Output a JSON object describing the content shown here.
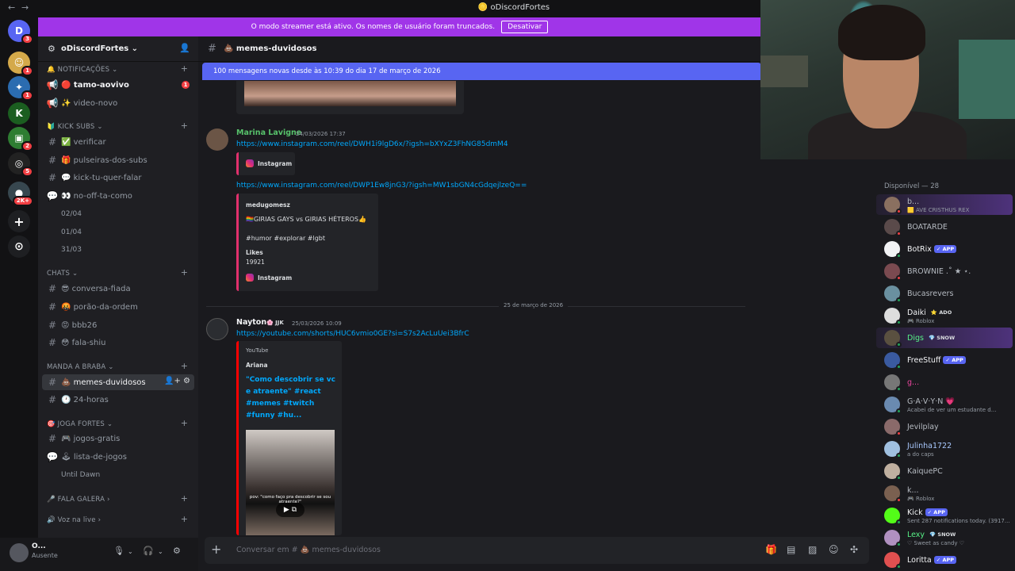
{
  "titlebar": {
    "back": "←",
    "forward": "→",
    "title": "oDiscordFortes"
  },
  "banner": {
    "text": "O modo streamer está ativo. Os nomes de usuário foram truncados.",
    "button": "Desativar"
  },
  "rail": {
    "servers": [
      {
        "label": "D",
        "badge": "3",
        "color": "#5865f2"
      },
      {
        "label": "☺",
        "badge": "1",
        "color": "#d4a94a"
      },
      {
        "label": "✦",
        "badge": "1",
        "color": "#2b6cb0"
      },
      {
        "label": "K",
        "badge": "",
        "color": "#1b5e20"
      },
      {
        "label": "▣",
        "badge": "2",
        "color": "#2e7d32"
      },
      {
        "label": "◎",
        "badge": "5",
        "color": "#222"
      },
      {
        "label": "●",
        "badge": "2K+",
        "color": "#37474f"
      }
    ],
    "add": "+",
    "explore": "⊙"
  },
  "server": {
    "name": "oDiscordFortes ⌄"
  },
  "sidebar": {
    "categories": [
      {
        "label": "🔔 NOTIFICAÇÕES ⌄"
      },
      {
        "label": "🔰 KICK SUBS ⌄"
      },
      {
        "label": "CHATS ⌄"
      },
      {
        "label": "MANDA A BRABA ⌄"
      },
      {
        "label": "🎯 JOGA FORTES ⌄"
      },
      {
        "label": "🎤 FALA GALERA ›"
      },
      {
        "label": "🔊 Voz na live ›"
      }
    ],
    "channels": [
      {
        "icon": "📢",
        "label": "🔴 tamo-aovivo",
        "badge": "1"
      },
      {
        "icon": "📢",
        "label": "✨ video-novo"
      },
      {
        "icon": "#",
        "label": "✅ verificar"
      },
      {
        "icon": "#",
        "label": "🎁 pulseiras-dos-subs"
      },
      {
        "icon": "#",
        "label": "💬 kick-tu-quer-falar"
      },
      {
        "icon": "💬",
        "label": "👀 no-off-ta-como"
      },
      {
        "icon": "#",
        "label": "😎 conversa-fiada"
      },
      {
        "icon": "#",
        "label": "🤬 porão-da-ordem"
      },
      {
        "icon": "#",
        "label": "😡 bbb26"
      },
      {
        "icon": "#",
        "label": "😳 fala-shiu"
      },
      {
        "icon": "#",
        "label": "💩 memes-duvidosos"
      },
      {
        "icon": "#",
        "label": "🕐 24-horas"
      },
      {
        "icon": "#",
        "label": "🎮 jogos-gratis"
      },
      {
        "icon": "💬",
        "label": "🕹 lista-de-jogos"
      }
    ],
    "threads": [
      "02/04",
      "01/04",
      "31/03",
      "Until Dawn"
    ]
  },
  "user": {
    "name": "O...",
    "status": "Ausente"
  },
  "channel": {
    "name": "💩 memes-duvidosos"
  },
  "newbar": "100 mensagens novas desde às 10:39 do dia 17 de março de 2026",
  "messages": [
    {
      "author": "Marina Lavigne",
      "timestamp": "24/03/2026 17:37",
      "link1": "https://www.instagram.com/reel/DWH1i9lgD6x/?igsh=bXYxZ3FhNG85dmM4",
      "embed1": "Instagram",
      "link2": "https://www.instagram.com/reel/DWP1Ew8jnG3/?igsh=MW1sbGN4cGdqejlzeQ==",
      "embed2": {
        "user": "medugomesz",
        "line1": "🏳️‍🌈GIRIAS GAYS vs GIRIAS HÉTEROS👍",
        "line2": "#humor #explorar #lgbt",
        "likes_label": "Likes",
        "likes": "19921",
        "source": "Instagram"
      }
    },
    {
      "author": "Nayton",
      "tag": "🌸 JJK",
      "timestamp": "25/03/2026 10:09",
      "link": "https://youtube.com/shorts/HUC6vmio0GE?si=S7s2AcLuUei3BfrC",
      "embed": {
        "provider": "YouTube",
        "channel": "Ariana",
        "title_lines": [
          "\"Como descobrir se vc",
          "e atraente\"  #react",
          "#memes #twitch",
          "#funny #hu..."
        ],
        "caption": "pov: \"como faço pra descobrir se sou atraente?\""
      }
    }
  ],
  "date_divider": "25 de março de 2026",
  "composer": {
    "placeholder": "Conversar em # 💩 memes-duvidosos"
  },
  "members": {
    "header": "Disponível — 28",
    "list": [
      {
        "name": "b...",
        "sub": "🟨 AVE CRISTHUS REX",
        "color": "#b5bac1",
        "status": "#f23f43"
      },
      {
        "name": "BOATARDE",
        "sub": "",
        "color": "#b5bac1",
        "status": "#f23f43"
      },
      {
        "name": "BotRix",
        "tag": "✓ APP",
        "sub": "",
        "color": "#f2f3f5",
        "status": "#23a55a"
      },
      {
        "name": "BROWNIE .˚ ★ ⋆.",
        "sub": "",
        "color": "#b5bac1",
        "status": "#f23f43"
      },
      {
        "name": "Bucasrevers",
        "sub": "",
        "color": "#b5bac1",
        "status": "#23a55a"
      },
      {
        "name": "Daiki",
        "tag": "⭐ ADO",
        "sub": "🎮 Roblox",
        "color": "#f2f3f5",
        "status": "#23a55a"
      },
      {
        "name": "Digs",
        "tag": "💎 SNOW",
        "sub": "",
        "color": "#57f287",
        "status": "#23a55a"
      },
      {
        "name": "FreeStuff",
        "tag": "✓ APP",
        "sub": "",
        "color": "#f2f3f5",
        "status": "#23a55a"
      },
      {
        "name": "g...",
        "sub": "",
        "color": "#eb459e",
        "status": "#23a55a"
      },
      {
        "name": "G·A·V·Y·N 💗",
        "sub": "Acabei de ver um estudante d...",
        "color": "#b5bac1",
        "status": "#23a55a"
      },
      {
        "name": "Jevilplay",
        "sub": "",
        "color": "#b5bac1",
        "status": "#f23f43"
      },
      {
        "name": "Julinha1722",
        "sub": "a do caps",
        "color": "#a9c9ff",
        "status": "#23a55a"
      },
      {
        "name": "KaiquePC",
        "sub": "",
        "color": "#b5bac1",
        "status": "#23a55a"
      },
      {
        "name": "k...",
        "sub": "🎮 Roblox",
        "color": "#b5bac1",
        "status": "#f23f43"
      },
      {
        "name": "Kick",
        "tag": "✓ APP",
        "sub": "Sent 287 notifications today. (3917...",
        "color": "#f2f3f5",
        "status": "#23a55a"
      },
      {
        "name": "Lexy",
        "tag": "💎 SNOW",
        "sub": "♡ Sweet as candy ♡",
        "color": "#57f287",
        "status": "#23a55a"
      },
      {
        "name": "Loritta",
        "tag": "✓ APP",
        "sub": "",
        "color": "#f2f3f5",
        "status": "#23a55a"
      }
    ]
  },
  "colors": {
    "accent": "#5865f2",
    "streamer_banner": "#a035e8",
    "link": "#00a8fc",
    "instagram": "#e1306c",
    "youtube": "#ff0000"
  }
}
